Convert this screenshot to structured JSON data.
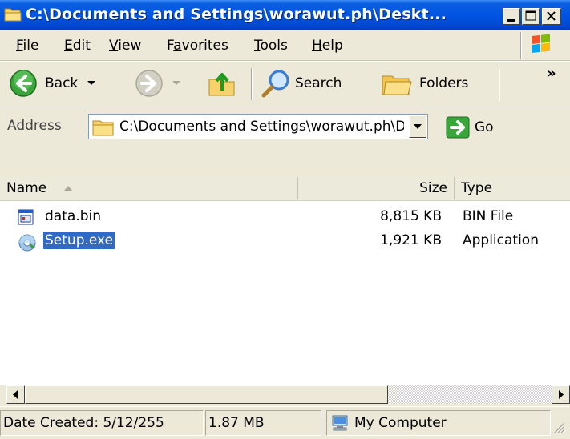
{
  "window": {
    "title": "C:\\Documents and Settings\\worawut.ph\\Deskt..."
  },
  "menu": {
    "items": [
      {
        "label": "File",
        "accel": "F"
      },
      {
        "label": "Edit",
        "accel": "E"
      },
      {
        "label": "View",
        "accel": "V"
      },
      {
        "label": "Favorites",
        "accel": "a"
      },
      {
        "label": "Tools",
        "accel": "T"
      },
      {
        "label": "Help",
        "accel": "H"
      }
    ]
  },
  "toolbar": {
    "back_label": "Back",
    "search_label": "Search",
    "folders_label": "Folders",
    "overflow": "»"
  },
  "address": {
    "label": "Address",
    "value": "C:\\Documents and Settings\\worawut.ph\\D",
    "go_label": "Go"
  },
  "list": {
    "columns": [
      {
        "label": "Name",
        "sort": "ascending"
      },
      {
        "label": "Size"
      },
      {
        "label": "Type"
      }
    ],
    "rows": [
      {
        "name": "data.bin",
        "size": "8,815 KB",
        "type": "BIN File",
        "icon": "bin-file-icon",
        "selected": false
      },
      {
        "name": "Setup.exe",
        "size": "1,921 KB",
        "type": "Application",
        "icon": "setup-exe-icon",
        "selected": true
      }
    ]
  },
  "status": {
    "date_created": "Date Created: 5/12/255",
    "size": "1.87 MB",
    "location": "My Computer"
  },
  "colors": {
    "titlebar": "#0054e3",
    "selection": "#316ac5",
    "chrome": "#ece9d8"
  }
}
